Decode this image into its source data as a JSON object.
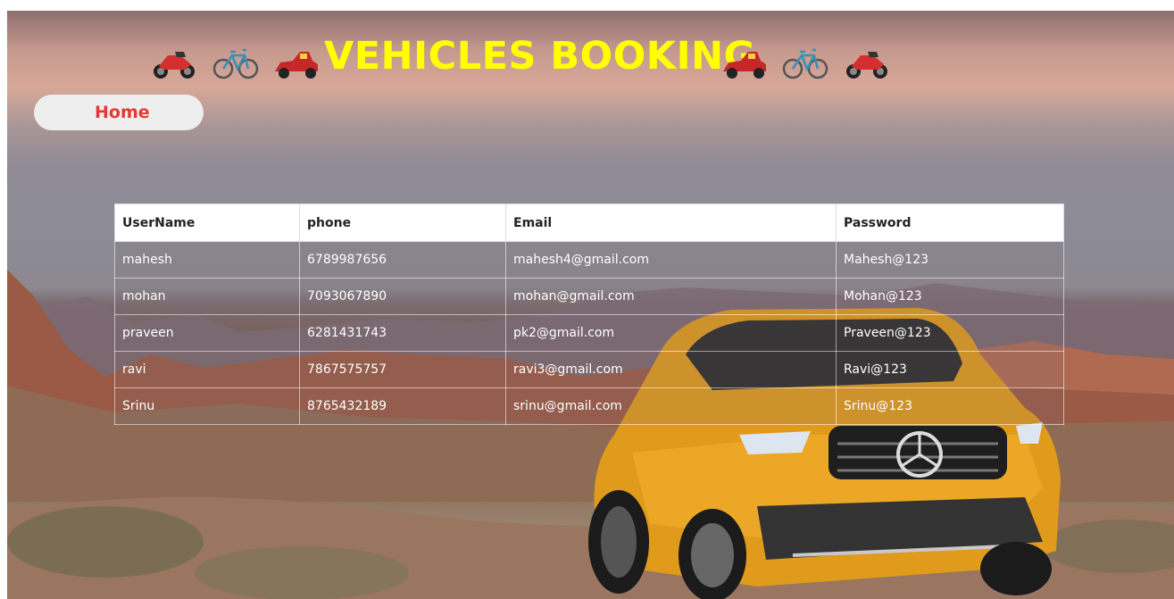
{
  "header": {
    "title": "VEHICLES BOOKING",
    "icons": [
      "motorcycle-icon",
      "bicycle-icon",
      "race-car-icon",
      "race-car-icon",
      "bicycle-icon",
      "motorcycle-icon"
    ],
    "title_color": "#ffff00"
  },
  "nav": {
    "home_label": "Home",
    "home_color": "#e53935"
  },
  "table": {
    "columns": [
      "UserName",
      "phone",
      "Email",
      "Password"
    ],
    "rows": [
      [
        "mahesh",
        "6789987656",
        "mahesh4@gmail.com",
        "Mahesh@123"
      ],
      [
        "mohan",
        "7093067890",
        "mohan@gmail.com",
        "Mohan@123"
      ],
      [
        "praveen",
        "6281431743",
        "pk2@gmail.com",
        "Praveen@123"
      ],
      [
        "ravi",
        "7867575757",
        "ravi3@gmail.com",
        "Ravi@123"
      ],
      [
        "Srinu",
        "8765432189",
        "srinu@gmail.com",
        "Srinu@123"
      ]
    ]
  }
}
